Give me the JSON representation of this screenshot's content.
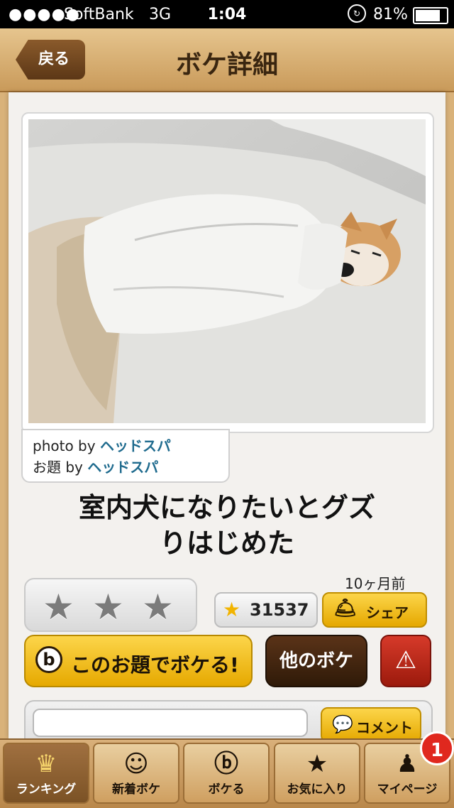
{
  "status_bar": {
    "signal": "●●●●●",
    "carrier": "SoftBank",
    "network": "3G",
    "time": "1:04",
    "battery": "81%"
  },
  "nav": {
    "back_label": "戻る",
    "title": "ボケ詳細"
  },
  "photo": {
    "credit_photo_prefix": "photo by",
    "credit_photo_user": "ヘッドスパ",
    "credit_topic_prefix": "お題 by",
    "credit_topic_user": "ヘッドスパ"
  },
  "caption": {
    "line1": "室内犬になりたいとグズ",
    "line2": "りはじめた"
  },
  "meta": {
    "time_ago": "10ヶ月前",
    "star_count": "31537",
    "share_label": "シェア"
  },
  "actions": {
    "boke_label": "このお題でボケる!",
    "other_label": "他のボケ"
  },
  "comment": {
    "placeholder": "",
    "button_label": "コメント"
  },
  "tabbar": {
    "items": [
      {
        "label": "ランキング",
        "icon": "crown-icon"
      },
      {
        "label": "新着ボケ",
        "icon": "face-icon"
      },
      {
        "label": "ボケる",
        "icon": "b-icon"
      },
      {
        "label": "お気に入り",
        "icon": "star-icon"
      },
      {
        "label": "マイページ",
        "icon": "user-icon"
      }
    ],
    "badge": "1"
  }
}
